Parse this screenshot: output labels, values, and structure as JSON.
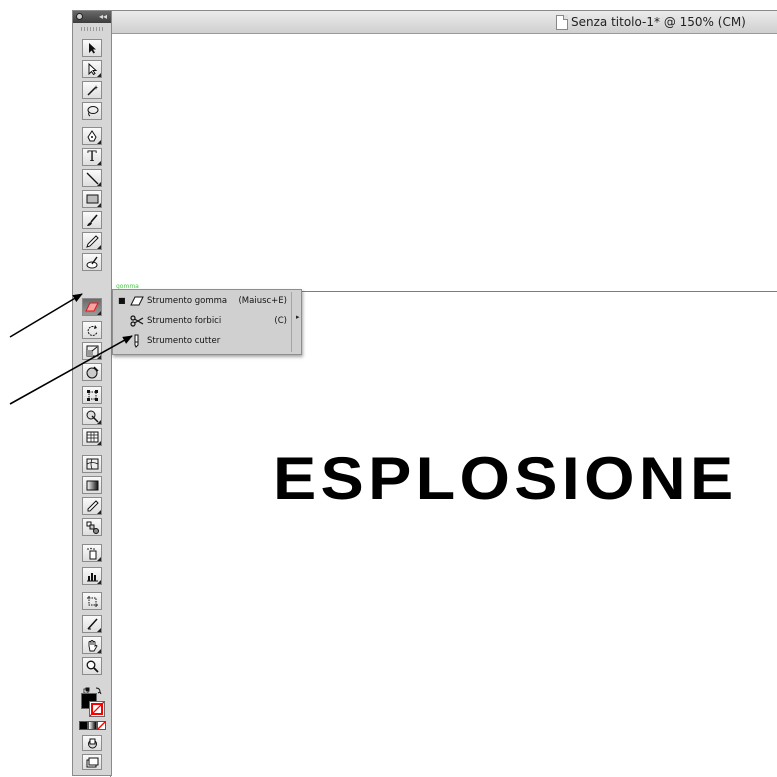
{
  "window": {
    "title": "Senza titolo-1* @ 150% (CM)"
  },
  "artboard": {
    "text": "ESPLOSIONE"
  },
  "tool_panel": {
    "tools": [
      {
        "name": "selection-tool",
        "icon": "selection-arrow-icon"
      },
      {
        "name": "direct-selection-tool",
        "icon": "direct-selection-icon"
      },
      {
        "name": "magic-wand-tool",
        "icon": "magic-wand-icon"
      },
      {
        "name": "lasso-tool",
        "icon": "lasso-icon"
      },
      {
        "name": "pen-tool",
        "icon": "pen-icon"
      },
      {
        "name": "type-tool",
        "icon": "type-icon"
      },
      {
        "name": "line-tool",
        "icon": "line-icon"
      },
      {
        "name": "rectangle-tool",
        "icon": "rectangle-icon"
      },
      {
        "name": "paintbrush-tool",
        "icon": "paintbrush-icon"
      },
      {
        "name": "pencil-tool",
        "icon": "pencil-icon"
      },
      {
        "name": "blob-brush-tool",
        "icon": "blob-brush-icon"
      },
      {
        "name": "eraser-tool",
        "icon": "eraser-icon"
      },
      {
        "name": "rotate-tool",
        "icon": "rotate-icon"
      },
      {
        "name": "scale-tool",
        "icon": "scale-icon"
      },
      {
        "name": "warp-tool",
        "icon": "warp-icon"
      },
      {
        "name": "free-transform-tool",
        "icon": "free-transform-icon"
      },
      {
        "name": "shape-builder-tool",
        "icon": "shape-builder-icon"
      },
      {
        "name": "perspective-grid-tool",
        "icon": "perspective-grid-icon"
      },
      {
        "name": "mesh-tool",
        "icon": "mesh-icon"
      },
      {
        "name": "gradient-tool",
        "icon": "gradient-icon"
      },
      {
        "name": "eyedropper-tool",
        "icon": "eyedropper-icon"
      },
      {
        "name": "blend-tool",
        "icon": "blend-icon"
      },
      {
        "name": "symbol-sprayer-tool",
        "icon": "symbol-sprayer-icon"
      },
      {
        "name": "column-graph-tool",
        "icon": "column-graph-icon"
      },
      {
        "name": "artboard-tool",
        "icon": "artboard-icon"
      },
      {
        "name": "slice-tool",
        "icon": "slice-icon"
      },
      {
        "name": "hand-tool",
        "icon": "hand-icon"
      },
      {
        "name": "zoom-tool",
        "icon": "zoom-icon"
      }
    ],
    "hover_label": "gomma"
  },
  "flyout_menu": {
    "items": [
      {
        "check": "■",
        "icon": "eraser-icon",
        "label": "Strumento gomma",
        "shortcut": "(Maiusc+E)"
      },
      {
        "check": "",
        "icon": "scissors-icon",
        "label": "Strumento forbici",
        "shortcut": "(C)"
      },
      {
        "check": "",
        "icon": "knife-icon",
        "label": "Strumento cutter",
        "shortcut": ""
      }
    ],
    "tearoff_arrow": "▸"
  },
  "colors": {
    "panel_bg": "#d6d6d6",
    "fill_color": "#000000",
    "stroke_color": "#ff0000"
  }
}
